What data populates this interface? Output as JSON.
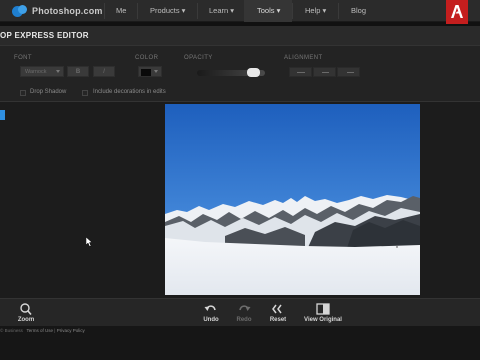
{
  "site": {
    "logo_text": "Photoshop.com",
    "nav": [
      {
        "label": "Me"
      },
      {
        "label": "Products ▾"
      },
      {
        "label": "Learn ▾"
      },
      {
        "label": "Tools ▾"
      },
      {
        "label": "Help ▾"
      },
      {
        "label": "Blog"
      }
    ],
    "brand_color": "#c41e1e"
  },
  "editor": {
    "title": "OP EXPRESS EDITOR"
  },
  "toolbar": {
    "font_label": "FONT",
    "font_value": "Warnock",
    "bold_label": "B",
    "italic_label": "I",
    "color_label": "COLOR",
    "color_value": "#0a0a0a",
    "opacity_label": "OPACITY",
    "opacity_level": 0.9,
    "alignment_label": "ALIGNMENT",
    "drop_shadow_label": "Drop Shadow",
    "decorations_label": "Include decorations in edits"
  },
  "canvas": {
    "image_icon": "snowy-mountain-photo"
  },
  "bottom": {
    "zoom_label": "Zoom",
    "undo_label": "Undo",
    "redo_label": "Redo",
    "reset_label": "Reset",
    "view_original_label": "View Original"
  },
  "footer": {
    "copyright": "© Business",
    "terms": "Terms of Use",
    "separator": "|",
    "privacy": "Privacy Policy"
  }
}
